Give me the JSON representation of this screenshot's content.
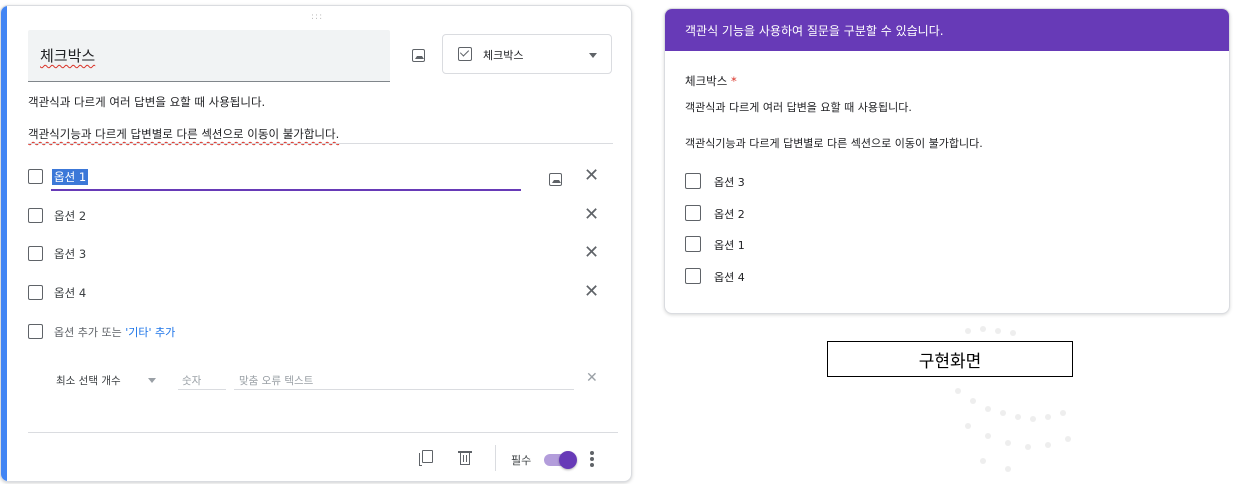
{
  "editor": {
    "drag_handle": ":::",
    "title_value": "체크박스",
    "question_type": "체크박스",
    "description_line1": "객관식과 다르게 여러 답변을 요할 때 사용됩니다.",
    "description_line2": "객관식기능과 다르게 답변별로 다른 섹션으로 이동이 불가합니다.",
    "options": [
      "옵션 1",
      "옵션 2",
      "옵션 3",
      "옵션 4"
    ],
    "add_option_label": "옵션 추가 또는 ",
    "add_other_label": "'기타' 추가",
    "validation": {
      "rule": "최소 선택 개수",
      "number_placeholder": "숫자",
      "error_text_placeholder": "맞춤 오류 텍스트"
    },
    "required_label": "필수",
    "required_on": true,
    "accent_color": "#4285f4",
    "toggle_color": "#673ab7"
  },
  "preview": {
    "banner_text": "객관식 기능을 사용하여 질문을 구분할 수 있습니다.",
    "banner_color": "#673ab7",
    "question_title": "체크박스",
    "required_star": "*",
    "description_line1": "객관식과 다르게 여러 답변을 요할 때 사용됩니다.",
    "description_line2": "객관식기능과 다르게 답변별로 다른 섹션으로 이동이 불가합니다.",
    "options": [
      "옵션 3",
      "옵션 2",
      "옵션 1",
      "옵션 4"
    ]
  },
  "caption": "구현화면"
}
